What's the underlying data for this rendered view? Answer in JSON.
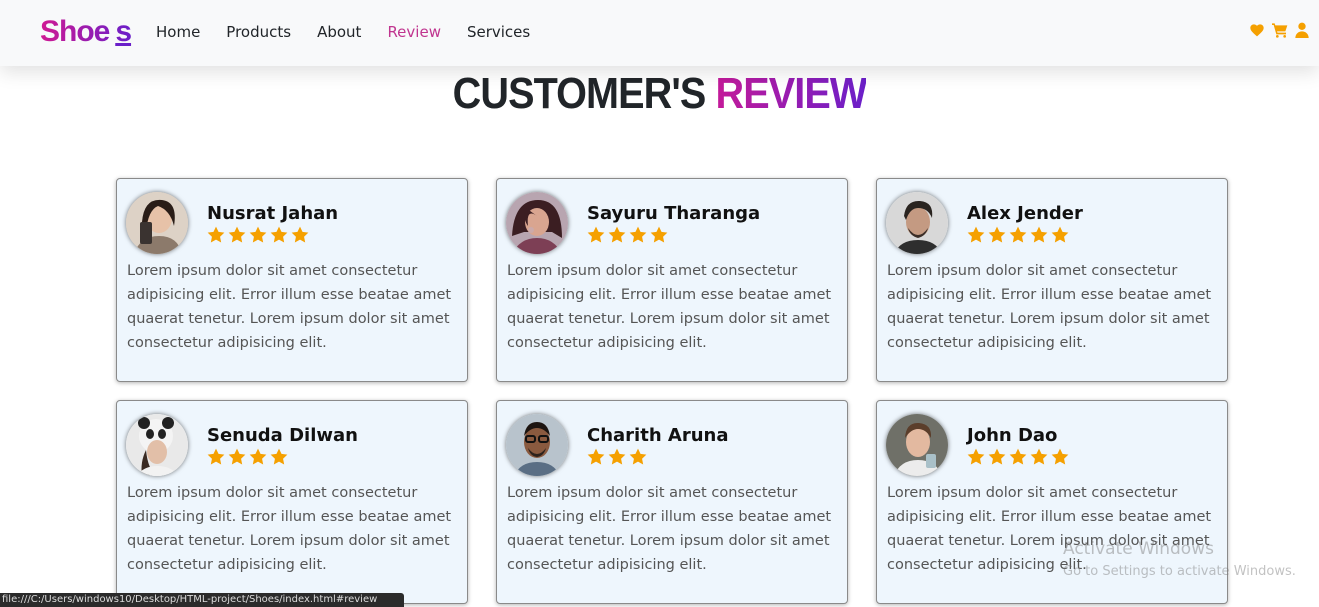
{
  "brand": {
    "name": "Shoe",
    "suffix": "s"
  },
  "nav": {
    "items": [
      "Home",
      "Products",
      "About",
      "Review",
      "Services"
    ],
    "active": "Review",
    "icons": [
      "heart-icon",
      "cart-icon",
      "user-icon"
    ],
    "icon_color": "#f5a000"
  },
  "section": {
    "title_main": "CUSTOMER'S",
    "title_accent": "REVIEW"
  },
  "reviews": [
    {
      "name": "Nusrat Jahan",
      "rating": 5,
      "text": "Lorem ipsum dolor sit amet consectetur adipisicing elit. Error illum esse beatae amet quaerat tenetur. Lorem ipsum dolor sit amet consectetur adipisicing elit."
    },
    {
      "name": "Sayuru Tharanga",
      "rating": 4,
      "text": "Lorem ipsum dolor sit amet consectetur adipisicing elit. Error illum esse beatae amet quaerat tenetur. Lorem ipsum dolor sit amet consectetur adipisicing elit."
    },
    {
      "name": "Alex Jender",
      "rating": 5,
      "text": "Lorem ipsum dolor sit amet consectetur adipisicing elit. Error illum esse beatae amet quaerat tenetur. Lorem ipsum dolor sit amet consectetur adipisicing elit."
    },
    {
      "name": "Senuda Dilwan",
      "rating": 4,
      "text": "Lorem ipsum dolor sit amet consectetur adipisicing elit. Error illum esse beatae amet quaerat tenetur. Lorem ipsum dolor sit amet consectetur adipisicing elit."
    },
    {
      "name": "Charith Aruna",
      "rating": 3,
      "text": "Lorem ipsum dolor sit amet consectetur adipisicing elit. Error illum esse beatae amet quaerat tenetur. Lorem ipsum dolor sit amet consectetur adipisicing elit."
    },
    {
      "name": "John Dao",
      "rating": 5,
      "text": "Lorem ipsum dolor sit amet consectetur adipisicing elit. Error illum esse beatae amet quaerat tenetur. Lorem ipsum dolor sit amet consectetur adipisicing elit."
    }
  ],
  "star_color": "#f5a000",
  "status_bar": {
    "url": "file:///C:/Users/windows10/Desktop/HTML-project/Shoes/index.html#review"
  },
  "watermark": {
    "title": "Activate Windows",
    "subtitle": "Go to Settings to activate Windows."
  }
}
